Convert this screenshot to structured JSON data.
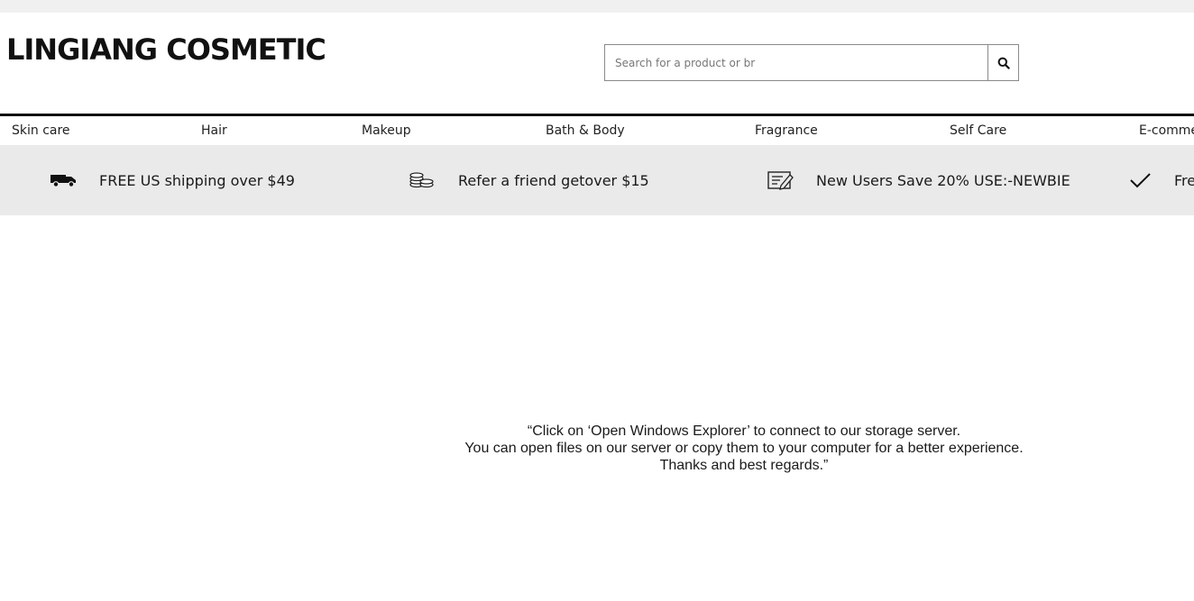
{
  "brand": {
    "logo_text": "LINGIANG COSMETIC"
  },
  "search": {
    "placeholder": "Search for a product or br",
    "value": "",
    "button_icon": "search-icon"
  },
  "nav": {
    "items": [
      {
        "label": "Skin care"
      },
      {
        "label": "Hair"
      },
      {
        "label": "Makeup"
      },
      {
        "label": "Bath & Body"
      },
      {
        "label": "Fragrance"
      },
      {
        "label": "Self Care"
      },
      {
        "label": "E-comme"
      }
    ]
  },
  "promo": {
    "items": [
      {
        "icon": "truck-icon",
        "text": "FREE US shipping over $49"
      },
      {
        "icon": "coins-icon",
        "text": "Refer a friend getover $15"
      },
      {
        "icon": "edit-note-icon",
        "text": "New Users Save 20% USE:-NEWBIE"
      },
      {
        "icon": "checkmark-icon",
        "text": "Fre"
      }
    ]
  },
  "message": {
    "lines": [
      "“Click on ‘Open Windows Explorer’ to connect to our storage server.",
      "You can open files on our server or copy them to your computer for a better experience.",
      "Thanks and best regards.”"
    ]
  },
  "colors": {
    "topbar": "#f0f0f0",
    "promo_bg": "#ebeaea",
    "divider": "#111111",
    "text": "#1a1a1a"
  }
}
